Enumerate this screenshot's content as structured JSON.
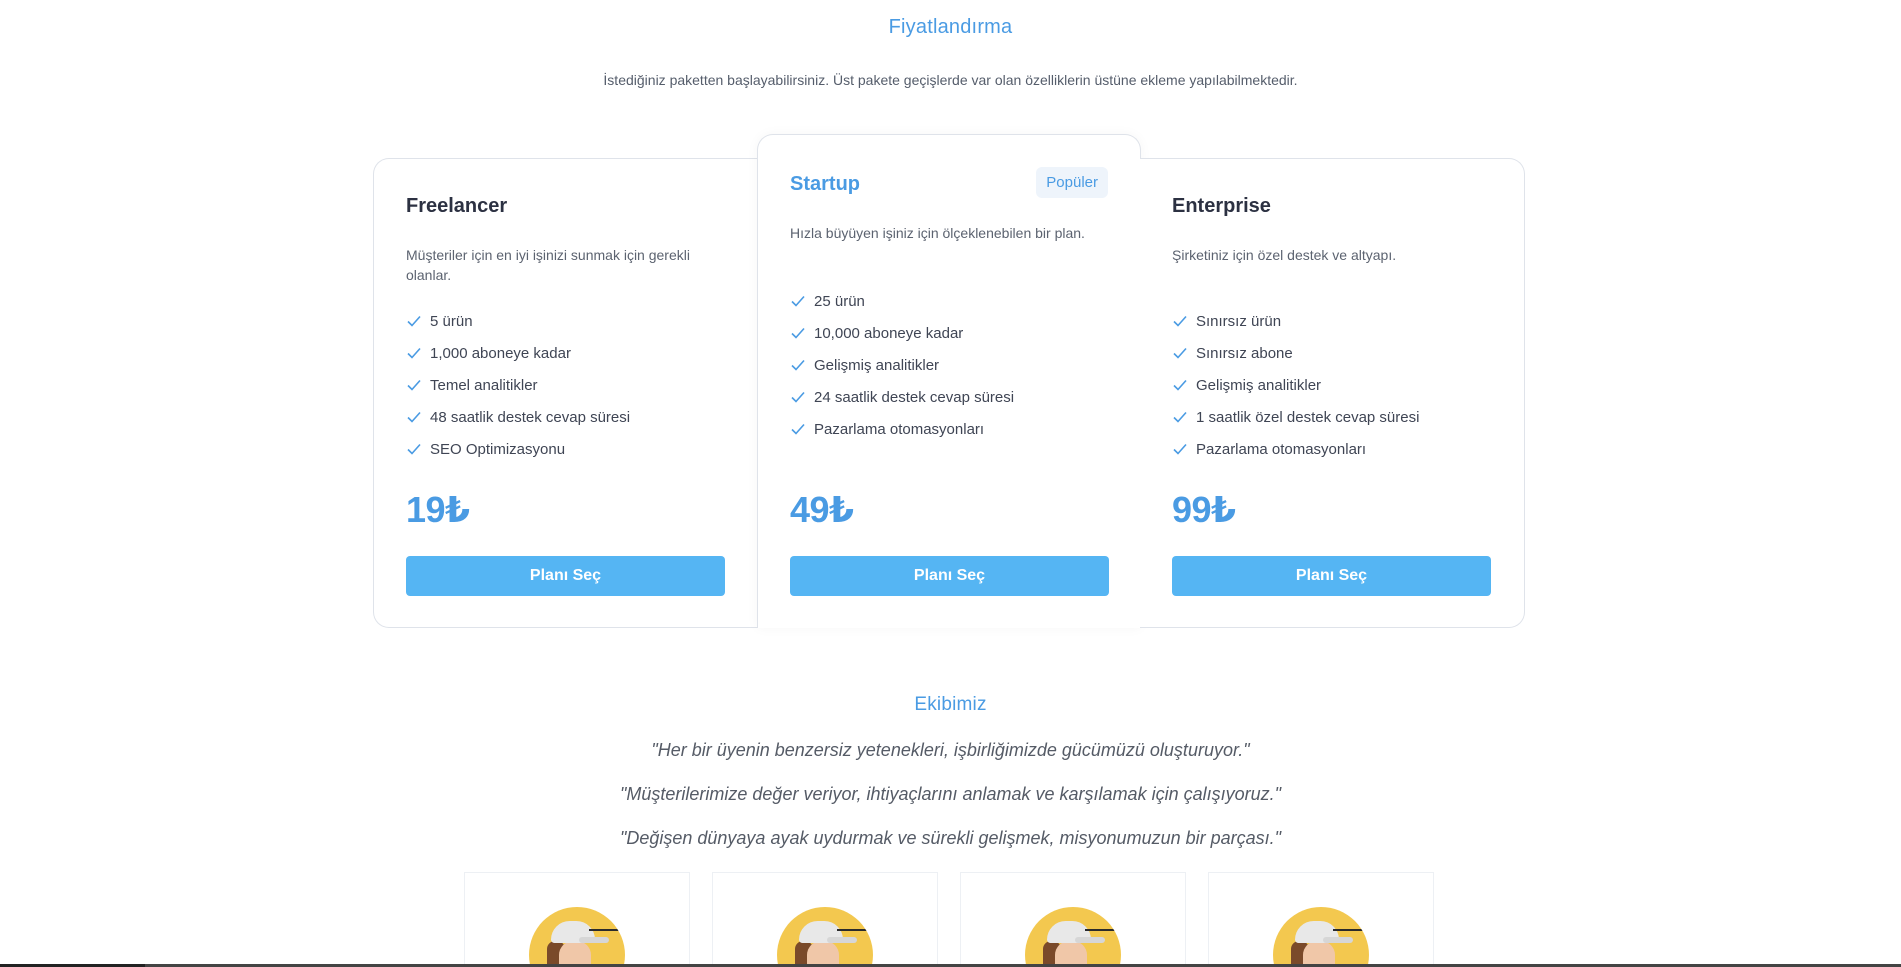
{
  "pricing": {
    "title": "Fiyatlandırma",
    "subtitle": "İstediğiniz paketten başlayabilirsiniz. Üst pakete geçişlerde var olan özelliklerin üstüne ekleme yapılabilmektedir.",
    "plans": [
      {
        "name": "Freelancer",
        "description": "Müşteriler için en iyi işinizi sunmak için gerekli olanlar.",
        "features": [
          "5 ürün",
          "1,000 aboneye kadar",
          "Temel analitikler",
          "48 saatlik destek cevap süresi",
          "SEO Optimizasyonu"
        ],
        "price": "19₺",
        "button": "Planı Seç"
      },
      {
        "name": "Startup",
        "badge": "Popüler",
        "description": "Hızla büyüyen işiniz için ölçeklenebilen bir plan.",
        "features": [
          "25 ürün",
          "10,000 aboneye kadar",
          "Gelişmiş analitikler",
          "24 saatlik destek cevap süresi",
          "Pazarlama otomasyonları"
        ],
        "price": "49₺",
        "button": "Planı Seç"
      },
      {
        "name": "Enterprise",
        "description": "Şirketiniz için özel destek ve altyapı.",
        "features": [
          "Sınırsız ürün",
          "Sınırsız abone",
          "Gelişmiş analitikler",
          "1 saatlik özel destek cevap süresi",
          "Pazarlama otomasyonları"
        ],
        "price": "99₺",
        "button": "Planı Seç"
      }
    ]
  },
  "team": {
    "title": "Ekibimiz",
    "quotes": [
      "\"Her bir üyenin benzersiz yetenekleri, işbirliğimizde gücümüzü oluşturuyor.\"",
      "\"Müşterilerimize değer veriyor, ihtiyaçlarını anlamak ve karşılamak için çalışıyoruz.\"",
      "\"Değişen dünyaya ayak uydurmak ve sürekli gelişmek, misyonumuzun bir parçası.\""
    ]
  },
  "colors": {
    "accent": "#4a9be3",
    "button": "#55b5f3",
    "check": "#4a9be3"
  },
  "icons": {
    "feature": "check-icon",
    "member_photo": "avatar"
  }
}
